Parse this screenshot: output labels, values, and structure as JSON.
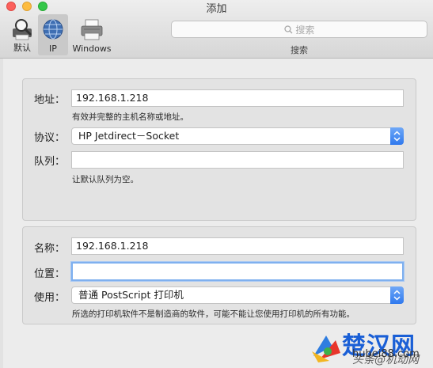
{
  "window": {
    "title": "添加"
  },
  "toolbar": {
    "items": [
      {
        "label": "默认",
        "icon": "magnifier-printer-icon",
        "selected": false
      },
      {
        "label": "IP",
        "icon": "globe-icon",
        "selected": true
      },
      {
        "label": "Windows",
        "icon": "printer-icon",
        "selected": false
      }
    ],
    "search": {
      "placeholder": "搜索",
      "caption": "搜索"
    }
  },
  "form1": {
    "address": {
      "label": "地址：",
      "value": "192.168.1.218",
      "hint": "有效并完整的主机名称或地址。"
    },
    "protocol": {
      "label": "协议：",
      "value": "HP Jetdirect－Socket"
    },
    "queue": {
      "label": "队列：",
      "value": "",
      "hint": "让默认队列为空。"
    }
  },
  "form2": {
    "name": {
      "label": "名称：",
      "value": "192.168.1.218"
    },
    "location": {
      "label": "位置：",
      "value": ""
    },
    "use": {
      "label": "使用：",
      "value": "普通 PostScript 打印机",
      "hint": "所选的打印机软件不是制造商的软件，可能不能让您使用打印机的所有功能。"
    }
  },
  "watermark": {
    "brand": "楚汉网",
    "url": "hubei88.com",
    "overlay": "头条@机动网"
  },
  "colors": {
    "accent": "#3a82f2",
    "focus_ring": "#7fb0ef",
    "panel": "#e3e3e3"
  }
}
